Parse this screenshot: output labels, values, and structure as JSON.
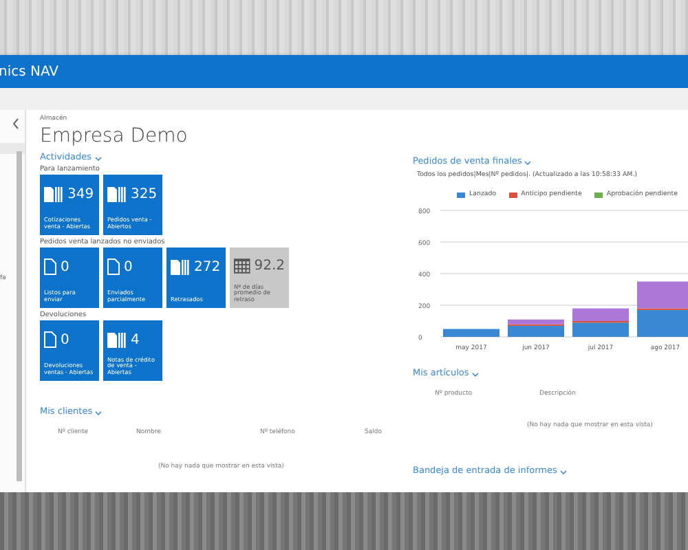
{
  "header": {
    "title": "nics NAV"
  },
  "sidebar": {
    "fragment": "fa"
  },
  "breadcrumb": "Almacén",
  "page_title": "Empresa Demo",
  "activities": {
    "title": "Actividades",
    "groups": [
      {
        "title": "Para lanzamiento",
        "tiles": [
          {
            "kind": "stack",
            "value": "349",
            "label": "Cotizaciones venta - Abiertas"
          },
          {
            "kind": "stack",
            "value": "325",
            "label": "Pedidos venta - Abiertos"
          }
        ]
      },
      {
        "title": "Pedidos venta lanzados no enviados",
        "tiles": [
          {
            "kind": "single",
            "value": "0",
            "label": "Listos para enviar"
          },
          {
            "kind": "single",
            "value": "0",
            "label": "Enviados parcialmente"
          },
          {
            "kind": "stack",
            "value": "272",
            "label": "Retrasados"
          },
          {
            "kind": "kpi",
            "value": "92.2",
            "label": "Nº de días promedio de retraso"
          }
        ]
      },
      {
        "title": "Devoluciones",
        "tiles": [
          {
            "kind": "single",
            "value": "0",
            "label": "Devoluciones ventas - Abiertas"
          },
          {
            "kind": "stack",
            "value": "4",
            "label": "Notas de crédito de venta - Abiertas"
          }
        ]
      }
    ]
  },
  "customers": {
    "title": "Mis clientes",
    "columns": [
      "Nº cliente",
      "Nombre",
      "Nº teléfono",
      "Saldo"
    ],
    "empty": "(No hay nada que mostrar en esta vista)"
  },
  "sales": {
    "title": "Pedidos de venta finales",
    "subtitle": "Todos los pedidos|Mes|Nº pedidos|. (Actualizado a las 10:58:33 AM.)",
    "chart_data": {
      "type": "bar",
      "stacked": true,
      "categories": [
        "may 2017",
        "jun 2017",
        "jul 2017",
        "ago 2017"
      ],
      "series": [
        {
          "name": "Lanzado",
          "color": "#3a87d2",
          "values": [
            50,
            70,
            90,
            170
          ]
        },
        {
          "name": "Anticipo pendiente",
          "color": "#d9503f",
          "values": [
            0,
            10,
            10,
            10
          ]
        },
        {
          "name": "Aprobación pendiente",
          "color": "#6ab04c",
          "values": [
            0,
            0,
            0,
            0
          ]
        },
        {
          "color": "#ab78d9",
          "values": [
            0,
            30,
            80,
            170
          ]
        }
      ],
      "grid": true,
      "ylim": [
        0,
        800
      ],
      "yticks": [
        0,
        200,
        400,
        600,
        800
      ]
    }
  },
  "items": {
    "title": "Mis artículos",
    "columns": [
      "Nº producto",
      "Descripción"
    ],
    "empty": "(No hay nada que mostrar en esta vista)"
  },
  "reports": {
    "title": "Bandeja de entrada de informes"
  }
}
